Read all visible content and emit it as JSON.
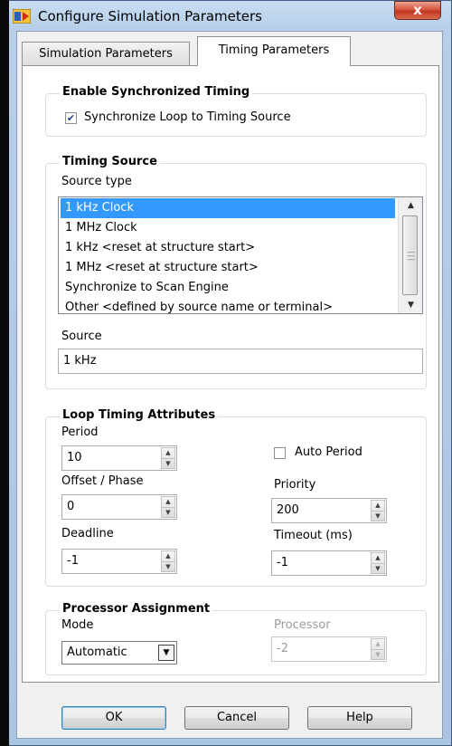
{
  "window": {
    "title": "Configure Simulation Parameters",
    "close_glyph": "x"
  },
  "tabs": [
    {
      "label": "Simulation Parameters",
      "selected": false
    },
    {
      "label": "Timing Parameters",
      "selected": true
    }
  ],
  "sync_timing": {
    "legend": "Enable Synchronized Timing",
    "checkbox_label": "Synchronize Loop to Timing Source",
    "checked": true
  },
  "timing_source": {
    "legend": "Timing Source",
    "source_type_label": "Source type",
    "items": [
      "1 kHz Clock",
      "1 MHz Clock",
      "1 kHz <reset at structure start>",
      "1 MHz <reset at structure start>",
      "Synchronize to Scan Engine",
      "Other <defined by source name or terminal>"
    ],
    "selected": "1 kHz Clock",
    "source_label": "Source",
    "source_value": "1 kHz"
  },
  "loop_timing": {
    "legend": "Loop Timing Attributes",
    "period_label": "Period",
    "period_value": "10",
    "auto_period_label": "Auto Period",
    "auto_period_checked": false,
    "offset_label": "Offset / Phase",
    "offset_value": "0",
    "priority_label": "Priority",
    "priority_value": "200",
    "deadline_label": "Deadline",
    "deadline_value": "-1",
    "timeout_label": "Timeout (ms)",
    "timeout_value": "-1"
  },
  "processor": {
    "legend": "Processor Assignment",
    "mode_label": "Mode",
    "mode_value": "Automatic",
    "processor_label": "Processor",
    "processor_value": "-2",
    "processor_enabled": false
  },
  "buttons": {
    "ok": "OK",
    "cancel": "Cancel",
    "help": "Help"
  },
  "icons": {
    "app": "labview-vi-icon",
    "close": "close-icon",
    "spin": "spinner-arrows-icon",
    "dropdown": "chevron-down-icon"
  }
}
